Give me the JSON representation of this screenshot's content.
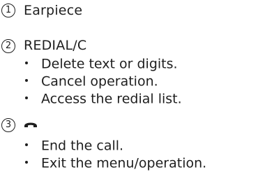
{
  "sections": [
    {
      "number": "1",
      "title": "Earpiece"
    },
    {
      "number": "2",
      "title": "REDIAL/C",
      "bullets": [
        "Delete text or digits.",
        "Cancel operation.",
        "Access the redial list."
      ]
    },
    {
      "number": "3",
      "icon": "end-call-handset-icon",
      "bullets": [
        "End the call.",
        "Exit the menu/operation."
      ]
    }
  ]
}
